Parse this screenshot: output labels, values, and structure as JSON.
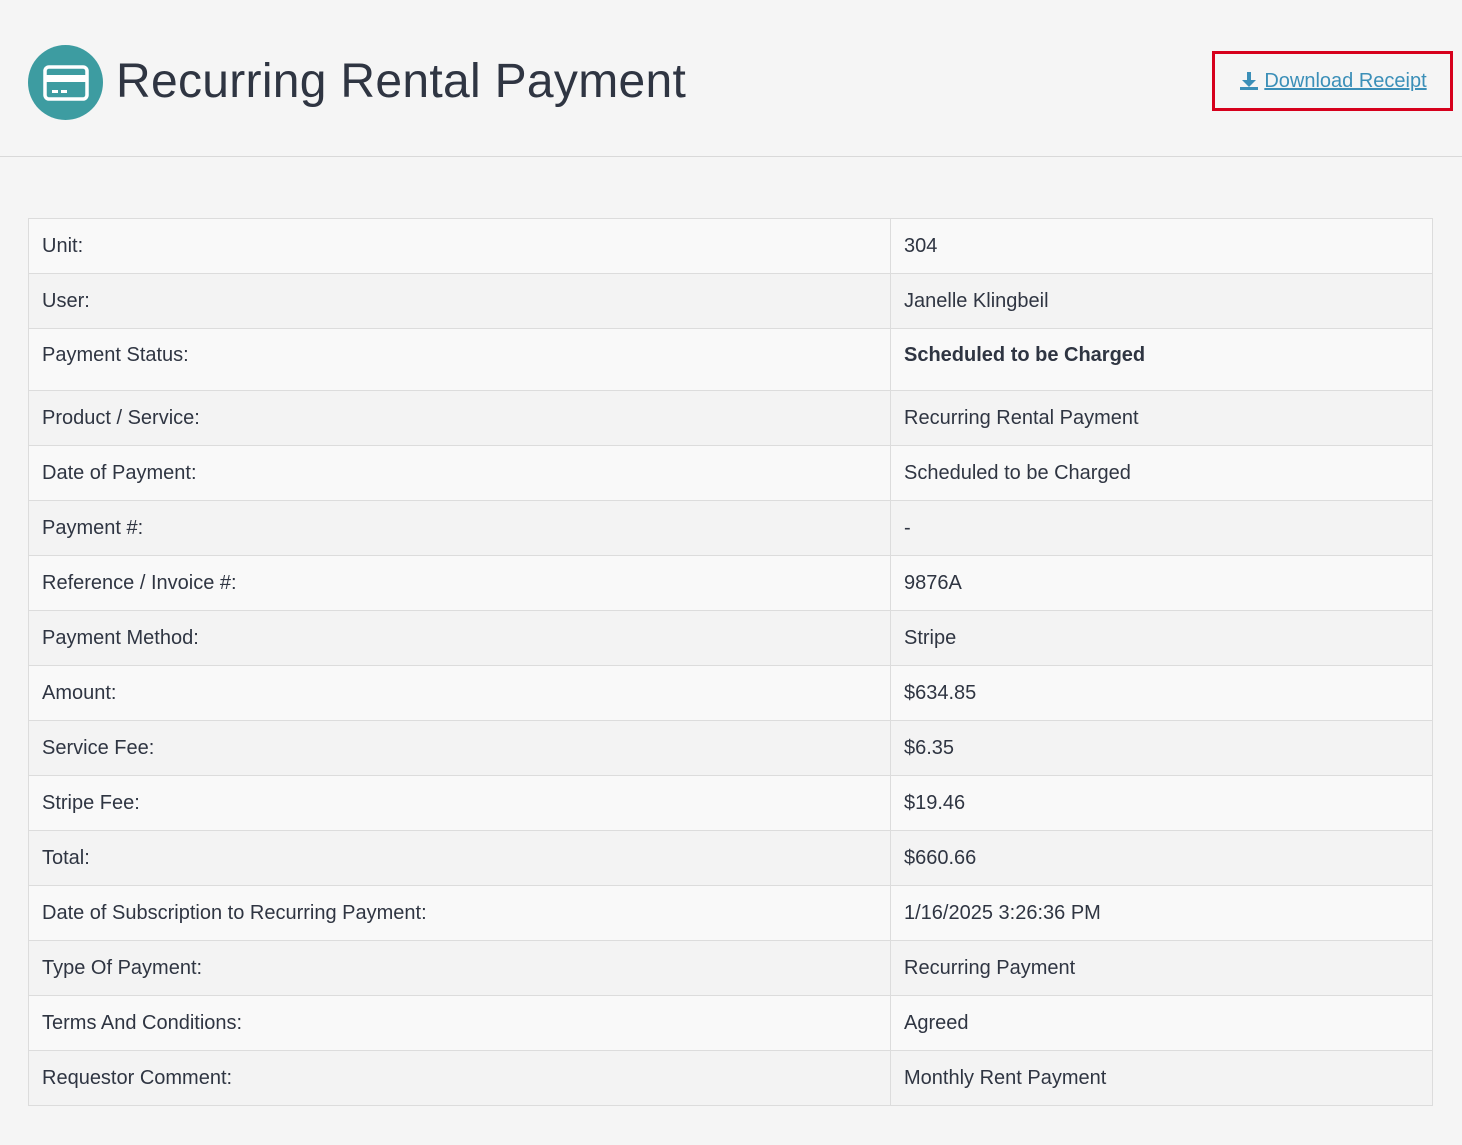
{
  "header": {
    "title": "Recurring Rental Payment",
    "icon": "credit-card-icon",
    "download_label": "Download Receipt",
    "download_icon": "download-icon"
  },
  "colors": {
    "accent": "#3d9ca1",
    "link": "#3b8fb8",
    "highlight_border": "#d6001c"
  },
  "rows": [
    {
      "label": "Unit:",
      "value": "304"
    },
    {
      "label": "User:",
      "value": "Janelle Klingbeil"
    },
    {
      "label": "Payment Status:",
      "value": "Scheduled to be Charged"
    },
    {
      "label": "Product / Service:",
      "value": "Recurring Rental Payment"
    },
    {
      "label": "Date of Payment:",
      "value": "Scheduled to be Charged"
    },
    {
      "label": "Payment #:",
      "value": "-"
    },
    {
      "label": "Reference / Invoice #:",
      "value": "9876A"
    },
    {
      "label": "Payment Method:",
      "value": "Stripe"
    },
    {
      "label": "Amount:",
      "value": "$634.85"
    },
    {
      "label": "Service Fee:",
      "value": "$6.35"
    },
    {
      "label": "Stripe Fee:",
      "value": "$19.46"
    },
    {
      "label": "Total:",
      "value": "$660.66"
    },
    {
      "label": "Date of Subscription to Recurring Payment:",
      "value": "1/16/2025 3:26:36 PM"
    },
    {
      "label": "Type Of Payment:",
      "value": "Recurring Payment"
    },
    {
      "label": "Terms And Conditions:",
      "value": "Agreed"
    },
    {
      "label": "Requestor Comment:",
      "value": "Monthly Rent Payment"
    }
  ]
}
